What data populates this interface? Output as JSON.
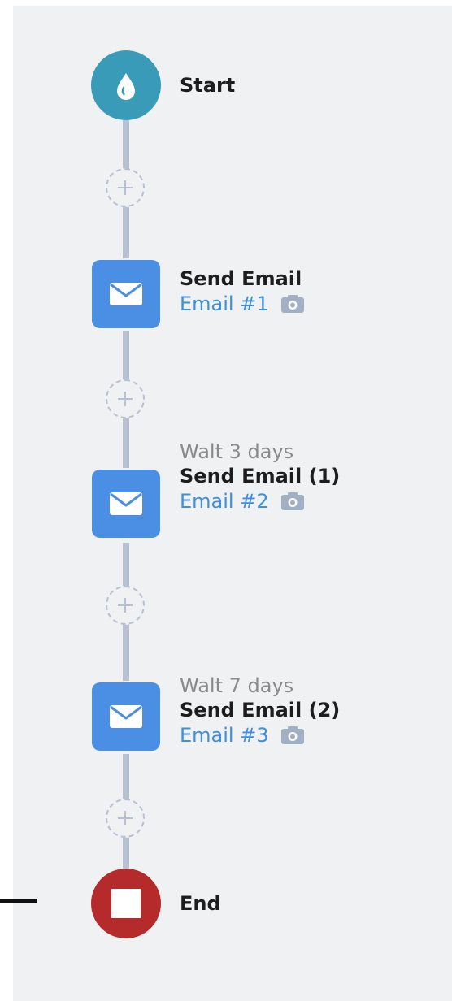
{
  "colors": {
    "start": "#3a9bb8",
    "email": "#4b8fe5",
    "end": "#b52a2a",
    "connector": "#b7c1d2",
    "link": "#3d8fe0"
  },
  "steps": {
    "start": {
      "title": "Start",
      "icon": "drop-icon"
    },
    "email1": {
      "title": "Send Email",
      "link": "Email #1",
      "icon": "envelope-icon"
    },
    "email2": {
      "wait": "Walt 3 days",
      "title": "Send Email",
      "suffix": "(1)",
      "link": "Email #2",
      "icon": "envelope-icon"
    },
    "email3": {
      "wait": "Walt 7 days",
      "title": "Send Email",
      "suffix": "(2)",
      "link": "Email #3",
      "icon": "envelope-icon"
    },
    "end": {
      "title": "End",
      "icon": "stop-icon"
    }
  },
  "add_step_icon": "plus-icon",
  "preview_icon": "camera-icon"
}
